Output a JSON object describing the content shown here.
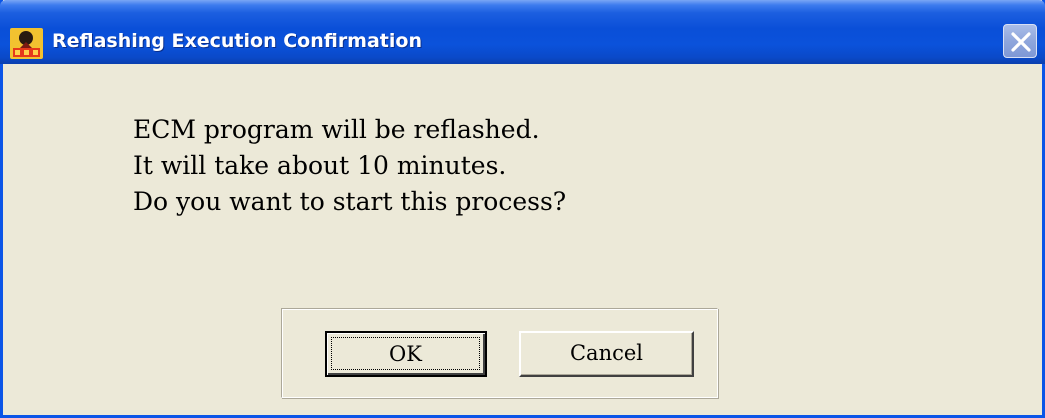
{
  "window": {
    "title": "Reflashing Execution Confirmation",
    "icon": "dds-app-icon",
    "close_icon": "close-icon"
  },
  "message": {
    "lines": [
      "ECM program will be reflashed.",
      "It will take about 10 minutes.",
      "Do you want to start this process?"
    ]
  },
  "buttons": {
    "ok_label": "OK",
    "cancel_label": "Cancel"
  },
  "colors": {
    "titlebar": "#0a4fd8",
    "window_bg": "#ece9d8",
    "border": "#0b55e7"
  }
}
